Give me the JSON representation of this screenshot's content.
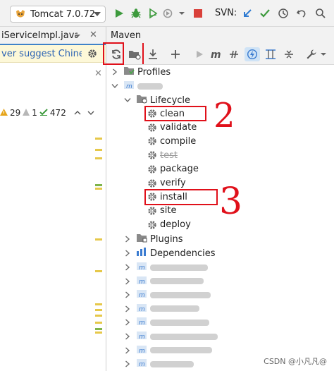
{
  "toolbar": {
    "run_config": "Tomcat 7.0.72",
    "svn_label": "SVN:",
    "colors": {
      "run": "#3d9a3d",
      "debug": "#3d9a3d",
      "stop": "#d9403a",
      "svn_update": "#2f7bd2",
      "svn_commit": "#3d9a3d"
    }
  },
  "editor": {
    "tab_title": "iServiceImpl.java",
    "notice_text": "ver suggest Chinese",
    "inspections": {
      "warnings": "29",
      "weak_warnings": "1",
      "typos": "472"
    }
  },
  "maven": {
    "panel_title": "Maven",
    "tree": {
      "profiles": "Profiles",
      "lifecycle": "Lifecycle",
      "phases": [
        {
          "label": "clean",
          "skipped": false
        },
        {
          "label": "validate",
          "skipped": false
        },
        {
          "label": "compile",
          "skipped": false
        },
        {
          "label": "test",
          "skipped": true
        },
        {
          "label": "package",
          "skipped": false
        },
        {
          "label": "verify",
          "skipped": false
        },
        {
          "label": "install",
          "skipped": false
        },
        {
          "label": "site",
          "skipped": false
        },
        {
          "label": "deploy",
          "skipped": false
        }
      ],
      "plugins": "Plugins",
      "dependencies": "Dependencies"
    }
  },
  "annotations": {
    "mark_clean": "2",
    "mark_install": "3"
  },
  "watermark": "CSDN @小凡凡@"
}
